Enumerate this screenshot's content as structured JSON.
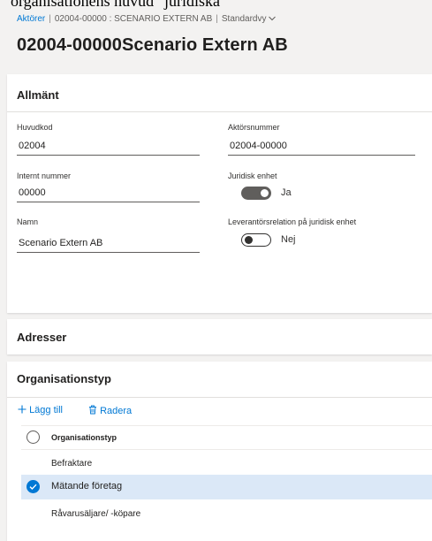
{
  "cutoff_top_text": "organisationens huvud \"juridiska",
  "breadcrumb": {
    "root": "Aktörer",
    "record": "02004-00000 : SCENARIO EXTERN AB",
    "view": "Standardvy"
  },
  "page_title": "02004-00000Scenario Extern AB",
  "general": {
    "header": "Allmänt",
    "huvudkod": {
      "label": "Huvudkod",
      "value": "02004"
    },
    "internt_nummer": {
      "label": "Internt nummer",
      "value": "00000"
    },
    "namn": {
      "label": "Namn",
      "value": "Scenario Extern AB"
    },
    "aktorsnummer": {
      "label": "Aktörsnummer",
      "value": "02004-00000"
    },
    "juridisk_enhet": {
      "label": "Juridisk enhet",
      "state": "Ja",
      "on": true
    },
    "leverantorsrelation": {
      "label": "Leverantörsrelation på juridisk enhet",
      "state": "Nej",
      "on": false
    }
  },
  "addresses": {
    "header": "Adresser"
  },
  "organisationstyp": {
    "header": "Organisationstyp",
    "add_label": "Lägg till",
    "delete_label": "Radera",
    "column_header": "Organisationstyp",
    "rows": [
      {
        "label": "Befraktare",
        "selected": false
      },
      {
        "label": "Mätande företag",
        "selected": true
      },
      {
        "label": "Råvarusäljare/ -köpare",
        "selected": false
      }
    ]
  },
  "colors": {
    "accent": "#0078d4",
    "selected_row": "#dbe8f7",
    "background": "#f3f2f1"
  }
}
